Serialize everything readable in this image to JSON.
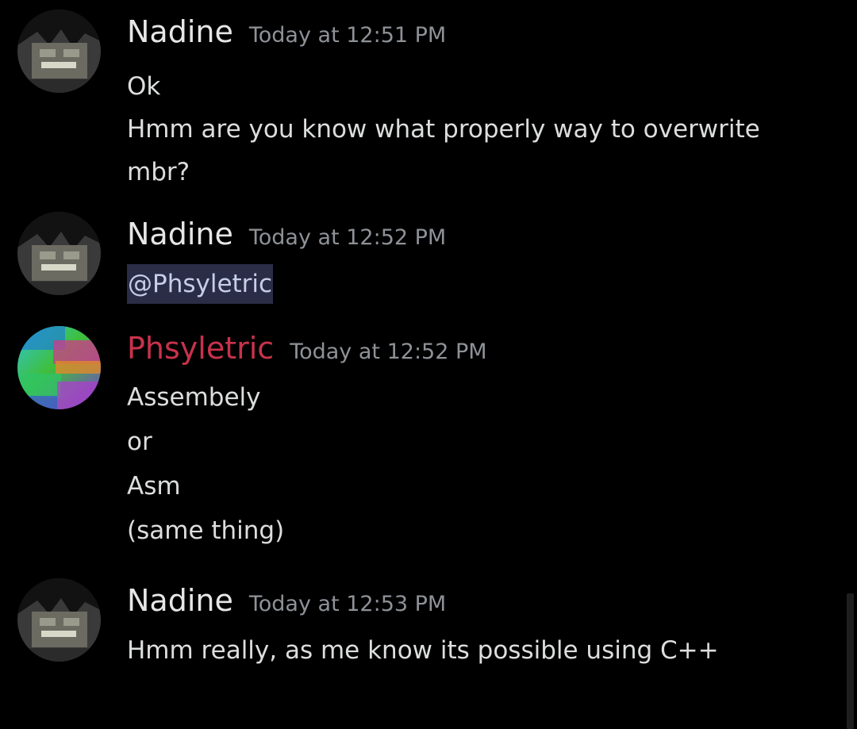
{
  "messages": [
    {
      "username": "Nadine",
      "timestamp": "Today at 12:51 PM",
      "avatar": "nadine-avatar-icon",
      "lines": [
        "Ok",
        "Hmm are you know what properly way to overwrite mbr?"
      ]
    },
    {
      "username": "Nadine",
      "timestamp": "Today at 12:52 PM",
      "avatar": "nadine-avatar-icon",
      "mention": "@Phsyletric"
    },
    {
      "username": "Phsyletric",
      "timestamp": "Today at 12:52 PM",
      "avatar": "phsyletric-avatar-icon",
      "username_color": "#c8324c",
      "lines": [
        "Assembely",
        "or",
        "Asm",
        "(same thing)"
      ]
    },
    {
      "username": "Nadine",
      "timestamp": "Today at 12:53 PM",
      "avatar": "nadine-avatar-icon",
      "lines": [
        "Hmm really, as me know its possible using C++"
      ]
    }
  ],
  "colors": {
    "background": "#000000",
    "text": "#dcddde",
    "timestamp": "#8e9297",
    "mention_bg": "#2a2d45",
    "pink_user": "#c8324c"
  }
}
